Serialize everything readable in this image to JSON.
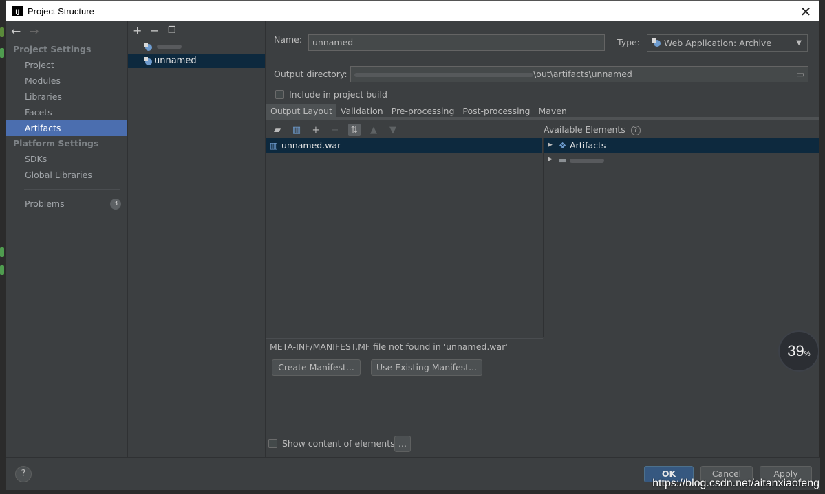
{
  "window": {
    "title": "Project Structure",
    "close_icon": "close-icon"
  },
  "sidebar": {
    "section_project": "Project Settings",
    "project_items": [
      {
        "label": "Project"
      },
      {
        "label": "Modules"
      },
      {
        "label": "Libraries"
      },
      {
        "label": "Facets"
      },
      {
        "label": "Artifacts"
      }
    ],
    "section_platform": "Platform Settings",
    "platform_items": [
      {
        "label": "SDKs"
      },
      {
        "label": "Global Libraries"
      }
    ],
    "problems": {
      "label": "Problems",
      "count": "3"
    }
  },
  "artifacts": {
    "toolbar": {
      "add": "+",
      "remove": "−"
    },
    "items": [
      {
        "label": ""
      },
      {
        "label": "unnamed"
      }
    ]
  },
  "form": {
    "name_label": "Name:",
    "name_value": "unnamed",
    "type_label": "Type:",
    "type_value": "Web Application: Archive",
    "output_label": "Output directory:",
    "output_value": "\\out\\artifacts\\unnamed",
    "include_label": "Include in project build"
  },
  "tabs": [
    {
      "label": "Output Layout"
    },
    {
      "label": "Validation"
    },
    {
      "label": "Pre-processing"
    },
    {
      "label": "Post-processing"
    },
    {
      "label": "Maven"
    }
  ],
  "layout": {
    "root_item": "unnamed.war",
    "available_label": "Available Elements",
    "available_items": [
      {
        "label": "Artifacts"
      },
      {
        "label": ""
      }
    ],
    "manifest_msg": "META-INF/MANIFEST.MF file not found in 'unnamed.war'",
    "create_manifest": "Create Manifest...",
    "use_existing": "Use Existing Manifest...",
    "show_content": "Show content of elements",
    "ellipsis": "..."
  },
  "footer": {
    "help": "?",
    "ok": "OK",
    "cancel": "Cancel",
    "apply": "Apply"
  },
  "overlay": {
    "progress_value": "39",
    "progress_unit": "%",
    "watermark": "https://blog.csdn.net/aitanxiaofeng"
  },
  "colors": {
    "accent": "#4b6eaf",
    "selection": "#0d293e",
    "background": "#3c3f41"
  }
}
